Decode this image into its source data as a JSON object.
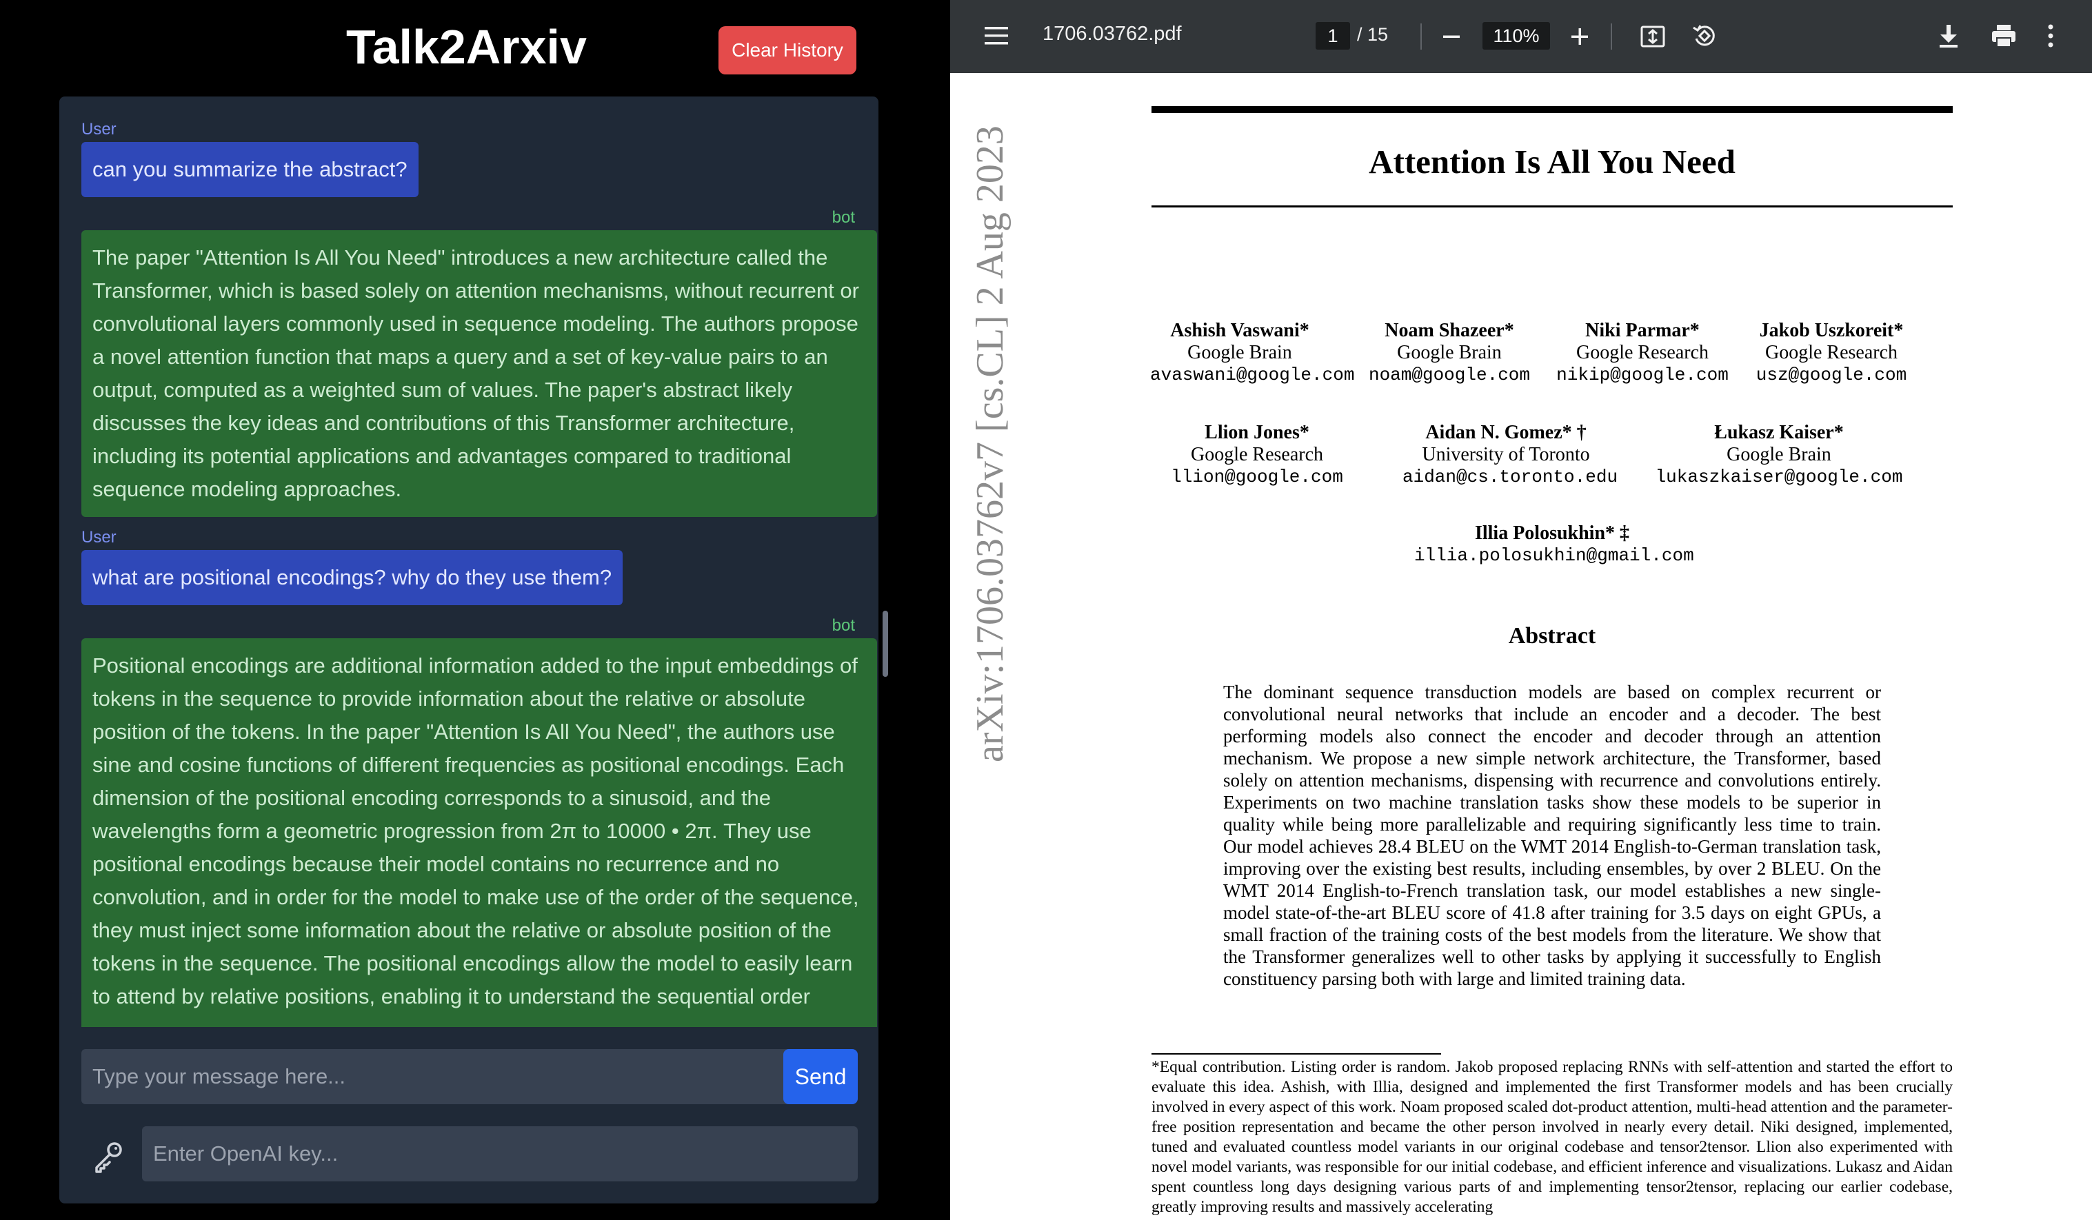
{
  "chat": {
    "app_title": "Talk2Arxiv",
    "clear_button": "Clear History",
    "messages": [
      {
        "role_label": "User",
        "text": "can you summarize the abstract?"
      },
      {
        "role_label": "bot",
        "text": "The paper \"Attention Is All You Need\" introduces a new architecture called the Transformer, which is based solely on attention mechanisms, without recurrent or convolutional layers commonly used in sequence modeling. The authors propose a novel attention function that maps a query and a set of key-value pairs to an output, computed as a weighted sum of values. The paper's abstract likely discusses the key ideas and contributions of this Transformer architecture, including its potential applications and advantages compared to traditional sequence modeling approaches."
      },
      {
        "role_label": "User",
        "text": "what are positional encodings? why do they use them?"
      },
      {
        "role_label": "bot",
        "text": "Positional encodings are additional information added to the input embeddings of tokens in the sequence to provide information about the relative or absolute position of the tokens. In the paper \"Attention Is All You Need\", the authors use sine and cosine functions of different frequencies as positional encodings. Each dimension of the positional encoding corresponds to a sinusoid, and the wavelengths form a geometric progression from 2π to 10000 • 2π. They use positional encodings because their model contains no recurrence and no convolution, and in order for the model to make use of the order of the sequence, they must inject some information about the relative or absolute position of the tokens in the sequence. The positional encodings allow the model to easily learn to attend by relative positions, enabling it to understand the sequential order"
      }
    ],
    "message_placeholder": "Type your message here...",
    "send_button": "Send",
    "key_placeholder": "Enter OpenAI key...",
    "icons": {
      "key": "key-icon"
    }
  },
  "pdf": {
    "filename": "1706.03762.pdf",
    "page_current": "1",
    "page_total": "/ 15",
    "zoom": "110%",
    "icons": [
      "menu-icon",
      "zoom-out-icon",
      "zoom-in-icon",
      "fit-page-icon",
      "rotate-icon",
      "download-icon",
      "print-icon",
      "more-options-icon"
    ],
    "paper": {
      "title": "Attention Is All You Need",
      "arxiv_stamp": "arXiv:1706.03762v7  [cs.CL]  2 Aug 2023",
      "authors": [
        {
          "name": "Ashish Vaswani*",
          "affiliation": "Google Brain",
          "email": "avaswani@google.com"
        },
        {
          "name": "Noam Shazeer*",
          "affiliation": "Google Brain",
          "email": "noam@google.com"
        },
        {
          "name": "Niki Parmar*",
          "affiliation": "Google Research",
          "email": "nikip@google.com"
        },
        {
          "name": "Jakob Uszkoreit*",
          "affiliation": "Google Research",
          "email": "usz@google.com"
        },
        {
          "name": "Llion Jones*",
          "affiliation": "Google Research",
          "email": "llion@google.com"
        },
        {
          "name": "Aidan N. Gomez* †",
          "affiliation": "University of Toronto",
          "email": "aidan@cs.toronto.edu"
        },
        {
          "name": "Łukasz Kaiser*",
          "affiliation": "Google Brain",
          "email": "lukaszkaiser@google.com"
        },
        {
          "name": "Illia Polosukhin* ‡",
          "affiliation": "",
          "email": "illia.polosukhin@gmail.com"
        }
      ],
      "abstract_heading": "Abstract",
      "abstract": "The dominant sequence transduction models are based on complex recurrent or convolutional neural networks that include an encoder and a decoder. The best performing models also connect the encoder and decoder through an attention mechanism. We propose a new simple network architecture, the Transformer, based solely on attention mechanisms, dispensing with recurrence and convolutions entirely. Experiments on two machine translation tasks show these models to be superior in quality while being more parallelizable and requiring significantly less time to train. Our model achieves 28.4 BLEU on the WMT 2014 English-to-German translation task, improving over the existing best results, including ensembles, by over 2 BLEU. On the WMT 2014 English-to-French translation task, our model establishes a new single-model state-of-the-art BLEU score of 41.8 after training for 3.5 days on eight GPUs, a small fraction of the training costs of the best models from the literature. We show that the Transformer generalizes well to other tasks by applying it successfully to English constituency parsing both with large and limited training data.",
      "footnote": "*Equal contribution. Listing order is random. Jakob proposed replacing RNNs with self-attention and started the effort to evaluate this idea. Ashish, with Illia, designed and implemented the first Transformer models and has been crucially involved in every aspect of this work. Noam proposed scaled dot-product attention, multi-head attention and the parameter-free position representation and became the other person involved in nearly every detail. Niki designed, implemented, tuned and evaluated countless model variants in our original codebase and tensor2tensor. Llion also experimented with novel model variants, was responsible for our initial codebase, and efficient inference and visualizations. Lukasz and Aidan spent countless long days designing various parts of and implementing tensor2tensor, replacing our earlier codebase, greatly improving results and massively accelerating"
    }
  }
}
